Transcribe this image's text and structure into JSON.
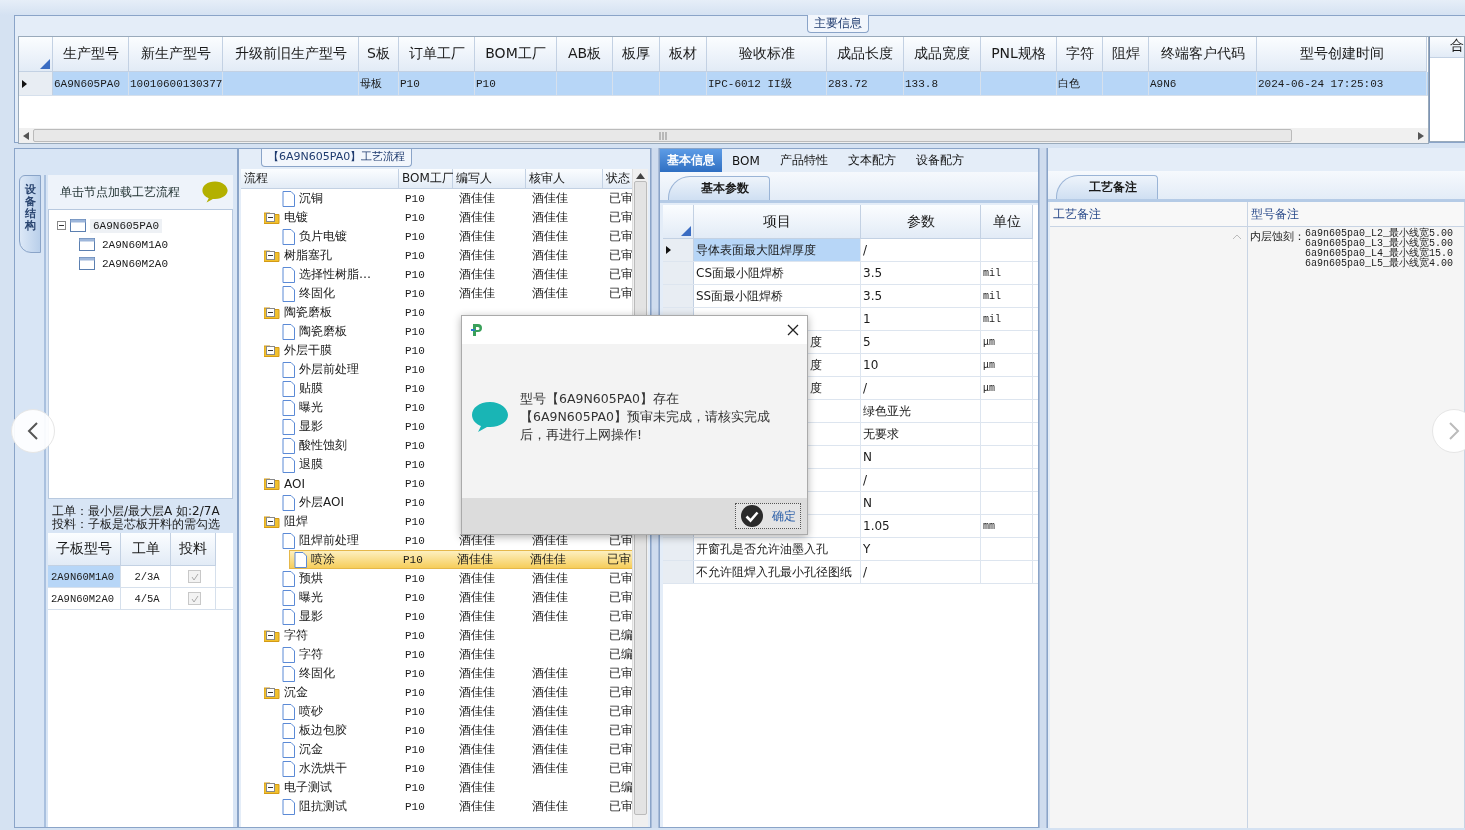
{
  "main_info": {
    "title": "主要信息",
    "columns": [
      "生产型号",
      "新生产型号",
      "升级前旧生产型号",
      "S板",
      "订单工厂",
      "BOM工厂",
      "AB板",
      "板厚",
      "板材",
      "验收标准",
      "成品长度",
      "成品宽度",
      "PNL规格",
      "字符",
      "阻焊",
      "终端客户代码",
      "型号创建时间"
    ],
    "rows": [
      {
        "selected": true,
        "cells": [
          "6A9N605PA0",
          "10010600130377",
          null,
          "母板",
          "P10",
          "P10",
          null,
          null,
          null,
          "IPC-6012 II级",
          "283.72",
          "133.8",
          null,
          "白色",
          null,
          "A9N6",
          "2024-06-24 17:25:03"
        ]
      }
    ],
    "side_column": "合"
  },
  "left_panel": {
    "vertical_tab": "设备结构",
    "header": "单击节点加载工艺流程",
    "tree": [
      {
        "label": "6A9N605PA0",
        "expanded": true,
        "children": [
          {
            "label": "2A9N60M1A0"
          },
          {
            "label": "2A9N60M2A0"
          }
        ]
      }
    ],
    "note": [
      "工单：最小层/最大层A 如:2/7A",
      "投料：子板是芯板开料的需勾选"
    ],
    "subgrid": {
      "columns": [
        "子板型号",
        "工单",
        "投料"
      ],
      "rows": [
        {
          "model": "2A9N60M1A0",
          "order": "2/3A",
          "feed": true,
          "selected": true
        },
        {
          "model": "2A9N60M2A0",
          "order": "4/5A",
          "feed": true,
          "selected": false
        }
      ]
    }
  },
  "process": {
    "title": "【6A9N605PA0】工艺流程",
    "columns": [
      "流程",
      "BOM工厂",
      "编写人",
      "核审人",
      "状态"
    ],
    "tree": [
      {
        "children": [
          {
            "label": "沉铜",
            "bom": "P10",
            "writer": "酒佳佳",
            "reviewer": "酒佳佳",
            "status": "已审"
          }
        ]
      },
      {
        "label": "电镀",
        "kind": "folder",
        "expanded": true,
        "bom": "P10",
        "writer": "酒佳佳",
        "reviewer": "酒佳佳",
        "status": "已审",
        "children": [
          {
            "label": "负片电镀",
            "bom": "P10",
            "writer": "酒佳佳",
            "reviewer": "酒佳佳",
            "status": "已审"
          }
        ]
      },
      {
        "label": "树脂塞孔",
        "kind": "folder",
        "expanded": true,
        "bom": "P10",
        "writer": "酒佳佳",
        "reviewer": "酒佳佳",
        "status": "已审",
        "children": [
          {
            "label": "选择性树脂…",
            "bom": "P10",
            "writer": "酒佳佳",
            "reviewer": "酒佳佳",
            "status": "已审"
          },
          {
            "label": "终固化",
            "bom": "P10",
            "writer": "酒佳佳",
            "reviewer": "酒佳佳",
            "status": "已审"
          }
        ]
      },
      {
        "label": "陶瓷磨板",
        "kind": "folder",
        "expanded": true,
        "bom": "P10",
        "children": [
          {
            "label": "陶瓷磨板",
            "bom": "P10"
          }
        ]
      },
      {
        "label": "外层干膜",
        "kind": "folder",
        "expanded": true,
        "bom": "P10",
        "children": [
          {
            "label": "外层前处理",
            "bom": "P10"
          },
          {
            "label": "贴膜",
            "bom": "P10"
          },
          {
            "label": "曝光",
            "bom": "P10"
          },
          {
            "label": "显影",
            "bom": "P10"
          },
          {
            "label": "酸性蚀刻",
            "bom": "P10"
          },
          {
            "label": "退膜",
            "bom": "P10"
          }
        ]
      },
      {
        "label": "AOI",
        "kind": "folder",
        "expanded": true,
        "bom": "P10",
        "children": [
          {
            "label": "外层AOI",
            "bom": "P10"
          }
        ]
      },
      {
        "label": "阻焊",
        "kind": "folder",
        "expanded": true,
        "bom": "P10",
        "children": [
          {
            "label": "阻焊前处理",
            "bom": "P10",
            "writer": "酒佳佳",
            "reviewer": "酒佳佳",
            "status": "已审"
          },
          {
            "label": "喷涂",
            "bom": "P10",
            "writer": "酒佳佳",
            "reviewer": "酒佳佳",
            "status": "已审",
            "selected": true
          },
          {
            "label": "预烘",
            "bom": "P10",
            "writer": "酒佳佳",
            "reviewer": "酒佳佳",
            "status": "已审"
          },
          {
            "label": "曝光",
            "bom": "P10",
            "writer": "酒佳佳",
            "reviewer": "酒佳佳",
            "status": "已审"
          },
          {
            "label": "显影",
            "bom": "P10",
            "writer": "酒佳佳",
            "reviewer": "酒佳佳",
            "status": "已审"
          }
        ]
      },
      {
        "label": "字符",
        "kind": "folder",
        "expanded": true,
        "bom": "P10",
        "writer": "酒佳佳",
        "status": "已编",
        "children": [
          {
            "label": "字符",
            "bom": "P10",
            "writer": "酒佳佳",
            "status": "已编"
          },
          {
            "label": "终固化",
            "bom": "P10",
            "writer": "酒佳佳",
            "reviewer": "酒佳佳",
            "status": "已审"
          }
        ]
      },
      {
        "label": "沉金",
        "kind": "folder",
        "expanded": true,
        "bom": "P10",
        "writer": "酒佳佳",
        "reviewer": "酒佳佳",
        "status": "已审",
        "children": [
          {
            "label": "喷砂",
            "bom": "P10",
            "writer": "酒佳佳",
            "reviewer": "酒佳佳",
            "status": "已审"
          },
          {
            "label": "板边包胶",
            "bom": "P10",
            "writer": "酒佳佳",
            "reviewer": "酒佳佳",
            "status": "已审"
          },
          {
            "label": "沉金",
            "bom": "P10",
            "writer": "酒佳佳",
            "reviewer": "酒佳佳",
            "status": "已审"
          },
          {
            "label": "水洗烘干",
            "bom": "P10",
            "writer": "酒佳佳",
            "reviewer": "酒佳佳",
            "status": "已审"
          }
        ]
      },
      {
        "label": "电子测试",
        "kind": "folder",
        "expanded": true,
        "bom": "P10",
        "writer": "酒佳佳",
        "status": "已编",
        "children": [
          {
            "label": "阻抗测试",
            "bom": "P10",
            "writer": "酒佳佳",
            "reviewer": "酒佳佳",
            "status": "已审"
          }
        ]
      }
    ]
  },
  "params": {
    "tabs": [
      {
        "label": "基本信息",
        "selected": true
      },
      {
        "label": "BOM",
        "selected": false
      },
      {
        "label": "产品特性",
        "selected": false
      },
      {
        "label": "文本配方",
        "selected": false
      },
      {
        "label": "设备配方",
        "selected": false
      }
    ],
    "subtab": "基本参数",
    "columns": [
      "项目",
      "参数",
      "单位"
    ],
    "rows": [
      {
        "kind": "full",
        "item": "导体表面最大阻焊厚度",
        "value": "/",
        "selected": true
      },
      {
        "kind": "full",
        "item": "CS面最小阻焊桥",
        "value": "3.5",
        "unit": "mil",
        "selected": false
      },
      {
        "kind": "full",
        "item": "SS面最小阻焊桥",
        "value": "3.5",
        "unit": "mil",
        "selected": false
      },
      {
        "kind": "full",
        "value": "1",
        "unit": "mil"
      },
      {
        "kind": "fragment",
        "item": "度",
        "value": "5",
        "unit": "μm"
      },
      {
        "kind": "fragment",
        "item": "度",
        "value": "10",
        "unit": "μm"
      },
      {
        "kind": "fragment",
        "item": "度",
        "value": "/",
        "unit": "μm"
      },
      {
        "kind": "full",
        "value": "绿色亚光"
      },
      {
        "kind": "full",
        "value": "无要求"
      },
      {
        "kind": "full",
        "value": "N"
      },
      {
        "kind": "full",
        "value": "/"
      },
      {
        "kind": "full",
        "value": "N"
      },
      {
        "kind": "full",
        "value": "1.05",
        "unit": "mm"
      },
      {
        "kind": "full",
        "item": "开窗孔是否允许油墨入孔",
        "value": "Y",
        "selected": false
      },
      {
        "kind": "full",
        "item": "不允许阻焊入孔最小孔径图纸",
        "value": "/",
        "selected": false
      }
    ]
  },
  "notes": {
    "tab": "工艺备注",
    "columns": [
      "工艺备注",
      "型号备注"
    ],
    "model_note": {
      "label": "内层蚀刻：",
      "lines": [
        "6a9n605pa0_L2_最小线宽5.00",
        "6a9n605pa0_L3_最小线宽5.00",
        "6a9n605pa0_L4_最小线宽15.0",
        "6a9n605pa0_L5_最小线宽4.00"
      ]
    }
  },
  "dialog": {
    "message": "型号【6A9N605PA0】存在【6A9N605PA0】预审未完成，请核实完成后，再进行上网操作!",
    "button": "确定"
  }
}
